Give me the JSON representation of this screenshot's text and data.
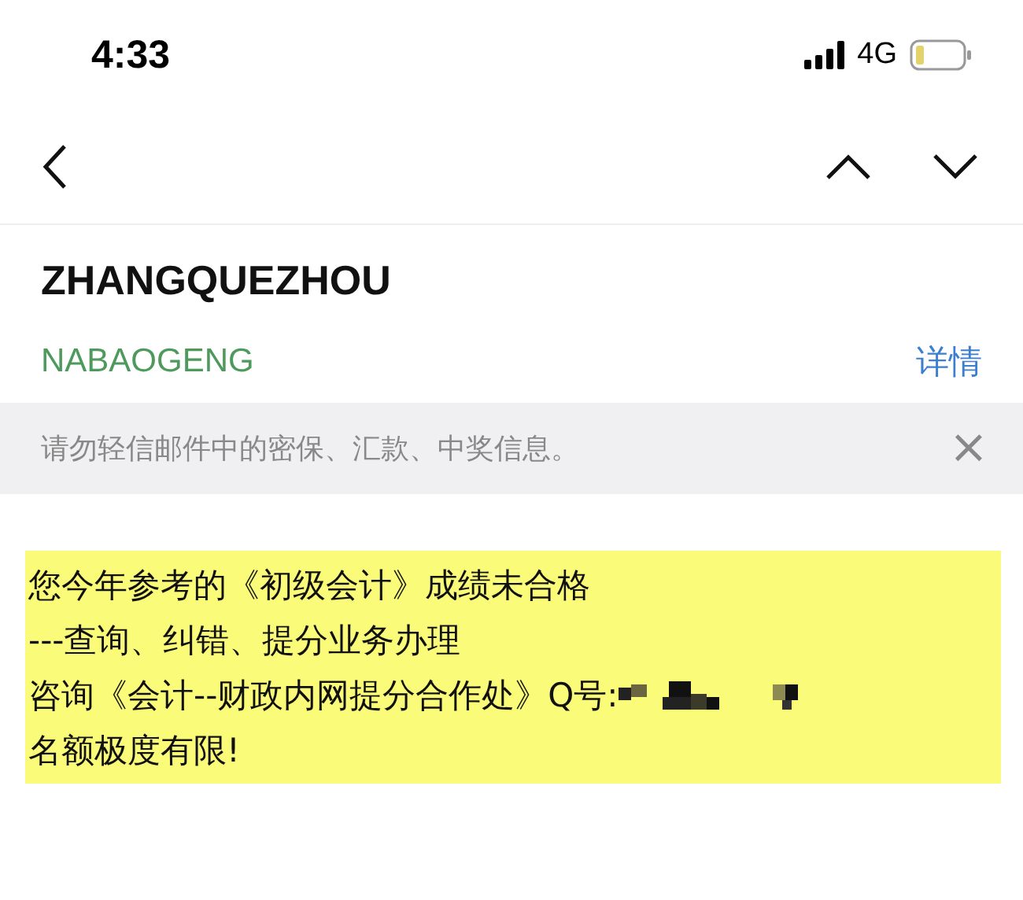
{
  "status_bar": {
    "time": "4:33",
    "network": "4G"
  },
  "message": {
    "subject": "ZHANGQUEZHOU",
    "sender": "NABAOGENG",
    "details_link": "详情"
  },
  "warning": {
    "text": "请勿轻信邮件中的密保、汇款、中奖信息。",
    "close": "×"
  },
  "body": {
    "lines": [
      {
        "text": "您今年参考的《初级会计》成绩未合格",
        "redacted": false
      },
      {
        "text": "---查询、纠错、提分业务办理",
        "redacted": false
      },
      {
        "text": "咨询《会计--财政内网提分合作处》Q号:",
        "redacted": true
      },
      {
        "text": "名额极度有限!",
        "redacted": false
      }
    ]
  }
}
